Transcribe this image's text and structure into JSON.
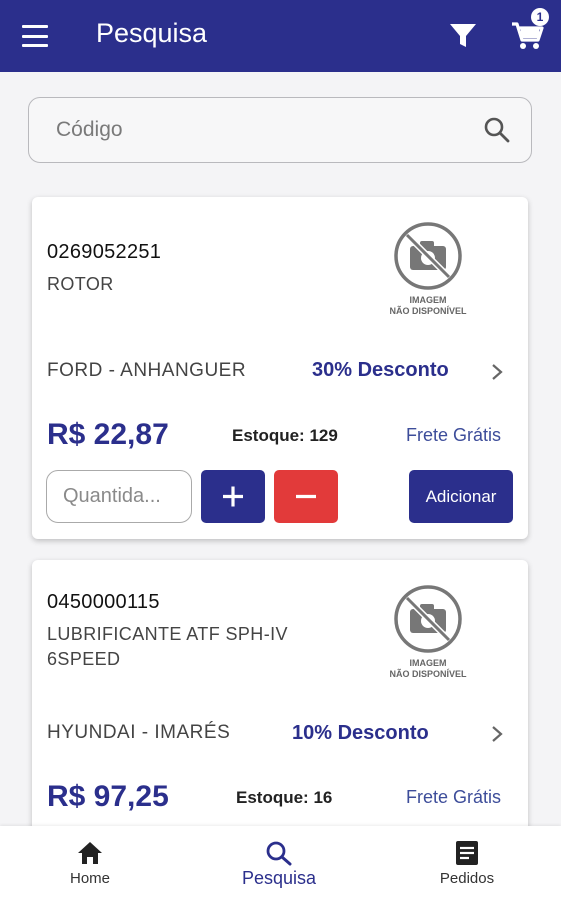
{
  "appbar": {
    "title": "Pesquisa",
    "cart_count": "1"
  },
  "search": {
    "placeholder": "Código"
  },
  "products": [
    {
      "code": "0269052251",
      "description": "ROTOR",
      "no_image_line1": "IMAGEM",
      "no_image_line2": "NÃO DISPONÍVEL",
      "brand": "FORD - ANHANGUER",
      "discount": "30% Desconto",
      "price": "R$ 22,87",
      "stock": "Estoque: 129",
      "shipping": "Frete Grátis",
      "quantity_placeholder": "Quantida...",
      "add_label": "Adicionar"
    },
    {
      "code": "0450000115",
      "description": "LUBRIFICANTE ATF SPH-IV 6SPEED",
      "no_image_line1": "IMAGEM",
      "no_image_line2": "NÃO DISPONÍVEL",
      "brand": "HYUNDAI - IMARÉS",
      "discount": "10% Desconto",
      "price": "R$ 97,25",
      "stock": "Estoque: 16",
      "shipping": "Frete Grátis"
    }
  ],
  "nav": {
    "home": "Home",
    "search": "Pesquisa",
    "orders": "Pedidos"
  },
  "colors": {
    "primary": "#2b2f8c",
    "danger": "#e23a3a",
    "background": "#f4f4f6"
  }
}
